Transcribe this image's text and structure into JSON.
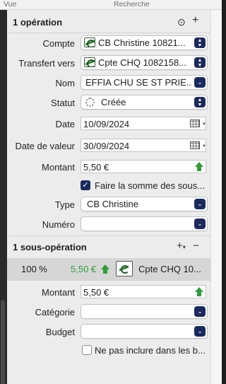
{
  "topbar": {
    "vue": "Vue",
    "recherche": "Recherche"
  },
  "operation": {
    "title": "1 opération",
    "compte": {
      "label": "Compte",
      "value": "CB Christine 10821..."
    },
    "transfert": {
      "label": "Transfert vers",
      "value": "Cpte CHQ 1082158..."
    },
    "nom": {
      "label": "Nom",
      "value": "EFFIA CHU SE ST PRIE..."
    },
    "statut": {
      "label": "Statut",
      "value": "Créée"
    },
    "date": {
      "label": "Date",
      "value": "10/09/2024"
    },
    "date_valeur": {
      "label": "Date de valeur",
      "value": "30/09/2024"
    },
    "montant": {
      "label": "Montant",
      "value": "5,50 €"
    },
    "faire_somme": {
      "label": "Faire la somme des sous...",
      "checked": true
    },
    "type": {
      "label": "Type",
      "value": "CB Christine"
    },
    "numero": {
      "label": "Numéro",
      "value": ""
    }
  },
  "sous_operation": {
    "title": "1 sous-opération",
    "row": {
      "percent": "100 %",
      "amount": "5,50 €",
      "account": "Cpte CHQ 10..."
    },
    "montant": {
      "label": "Montant",
      "value": "5,50 €"
    },
    "categorie": {
      "label": "Catégorie",
      "value": ""
    },
    "budget": {
      "label": "Budget",
      "value": ""
    },
    "ne_pas_inclure": {
      "label": "Ne pas inclure dans les b...",
      "checked": false
    }
  },
  "icons": {
    "more": "ellipsis-circle-icon",
    "add": "plus-icon",
    "bank": "credit-agricole-logo-icon",
    "calendar": "calendar-icon",
    "increase": "green-up-arrow-icon"
  },
  "colors": {
    "accent": "#1b2a5e",
    "positive": "#2e9e3a",
    "panel": "#ececec"
  }
}
